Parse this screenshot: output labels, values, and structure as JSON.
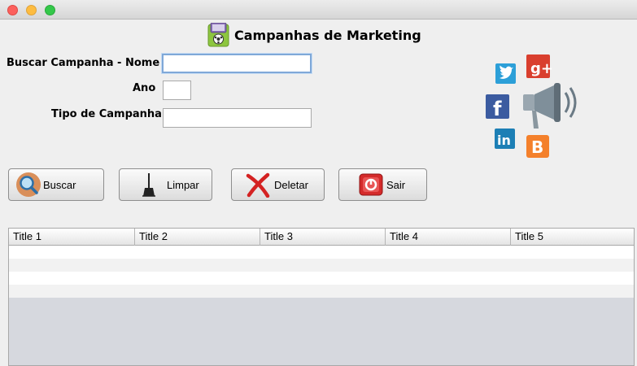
{
  "window": {
    "title": ""
  },
  "header": {
    "title": "Campanhas de Marketing",
    "icon": "campaign-badge-icon"
  },
  "form": {
    "nome": {
      "label": "Buscar Campanha - Nome",
      "value": ""
    },
    "ano": {
      "label": "Ano",
      "value": ""
    },
    "tipo": {
      "label": "Tipo de Campanha",
      "value": ""
    }
  },
  "buttons": {
    "buscar": {
      "label": "Buscar",
      "icon": "magnifier-icon"
    },
    "limpar": {
      "label": "Limpar",
      "icon": "broom-icon"
    },
    "deletar": {
      "label": "Deletar",
      "icon": "red-x-icon"
    },
    "sair": {
      "label": "Sair",
      "icon": "exit-icon"
    }
  },
  "social_icons": [
    "twitter-icon",
    "google-plus-icon",
    "facebook-icon",
    "megaphone-icon",
    "linkedin-icon",
    "blogger-icon"
  ],
  "social_text": {
    "gplus": "g+",
    "facebook": "f",
    "linkedin": "in",
    "blogger": "B"
  },
  "table": {
    "columns": [
      "Title 1",
      "Title 2",
      "Title 3",
      "Title 4",
      "Title 5"
    ],
    "rows": [
      [
        "",
        "",
        "",
        "",
        ""
      ],
      [
        "",
        "",
        "",
        "",
        ""
      ],
      [
        "",
        "",
        "",
        "",
        ""
      ],
      [
        "",
        "",
        "",
        "",
        ""
      ]
    ]
  },
  "colors": {
    "twitter": "#2c9fd8",
    "gplus": "#d93f2e",
    "facebook": "#3b5ba0",
    "linkedin": "#1c7fb5",
    "blogger": "#f4802b",
    "focus": "#7fa8d8"
  }
}
